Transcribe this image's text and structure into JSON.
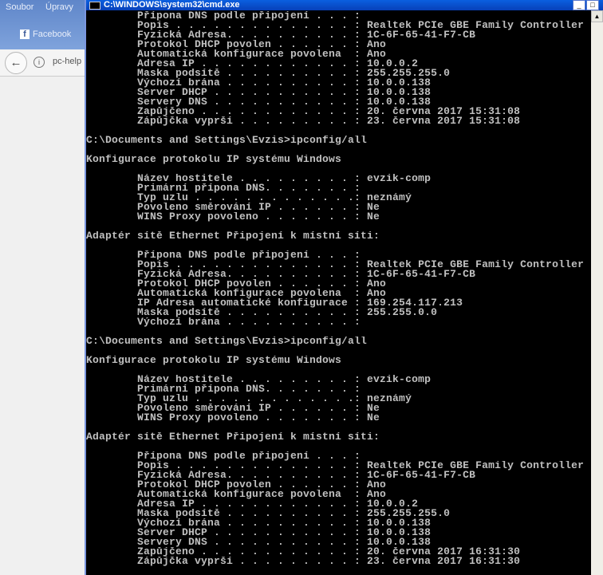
{
  "browser": {
    "menu": [
      "Soubor",
      "Úpravy"
    ],
    "facebook": "Facebook",
    "url": "pc-help",
    "back_icon": "←",
    "info_icon": "i"
  },
  "window": {
    "title": "C:\\WINDOWS\\system32\\cmd.exe",
    "min": "_",
    "max": "□"
  },
  "console": {
    "lines": [
      "        Přípona DNS podle připojení . . . : ",
      "        Popis . . . . . . . . . . . . . . : Realtek PCIe GBE Family Controller",
      "        Fyzická Adresa. . . . . . . . . . : 1C-6F-65-41-F7-CB",
      "        Protokol DHCP povolen . . . . . . : Ano",
      "        Automatická konfigurace povolena  : Ano",
      "        Adresa IP . . . . . . . . . . . . : 10.0.0.2",
      "        Maska podsítě . . . . . . . . . . : 255.255.255.0",
      "        Výchozí brána . . . . . . . . . . : 10.0.0.138",
      "        Server DHCP . . . . . . . . . . . : 10.0.0.138",
      "        Servery DNS . . . . . . . . . . . : 10.0.0.138",
      "        Zapůjčeno . . . . . . . . . . . . : 20. června 2017 15:31:08",
      "        Zápůjčka vyprší . . . . . . . . . : 23. června 2017 15:31:08",
      "",
      "C:\\Documents and Settings\\Evzis>ipconfig/all",
      "",
      "Konfigurace protokolu IP systému Windows",
      "",
      "        Název hostitele . . . . . . . . . : evzik-comp",
      "        Primární přípona DNS. . . . . . . : ",
      "        Typ uzlu . . . . . . . . . . . . .: neznámý",
      "        Povoleno směrování IP . . . . . . : Ne",
      "        WINS Proxy povoleno . . . . . . . : Ne",
      "",
      "Adaptér sítě Ethernet Připojení k místní síti:",
      "",
      "        Přípona DNS podle připojení . . . : ",
      "        Popis . . . . . . . . . . . . . . : Realtek PCIe GBE Family Controller",
      "        Fyzická Adresa. . . . . . . . . . : 1C-6F-65-41-F7-CB",
      "        Protokol DHCP povolen . . . . . . : Ano",
      "        Automatická konfigurace povolena  : Ano",
      "        IP Adresa automatické konfigurace : 169.254.117.213",
      "        Maska podsítě . . . . . . . . . . : 255.255.0.0",
      "        Výchozí brána . . . . . . . . . . : ",
      "",
      "C:\\Documents and Settings\\Evzis>ipconfig/all",
      "",
      "Konfigurace protokolu IP systému Windows",
      "",
      "        Název hostitele . . . . . . . . . : evzik-comp",
      "        Primární přípona DNS. . . . . . . : ",
      "        Typ uzlu . . . . . . . . . . . . .: neznámý",
      "        Povoleno směrování IP . . . . . . : Ne",
      "        WINS Proxy povoleno . . . . . . . : Ne",
      "",
      "Adaptér sítě Ethernet Připojení k místní síti:",
      "",
      "        Přípona DNS podle připojení . . . : ",
      "        Popis . . . . . . . . . . . . . . : Realtek PCIe GBE Family Controller",
      "        Fyzická Adresa. . . . . . . . . . : 1C-6F-65-41-F7-CB",
      "        Protokol DHCP povolen . . . . . . : Ano",
      "        Automatická konfigurace povolena  : Ano",
      "        Adresa IP . . . . . . . . . . . . : 10.0.0.2",
      "        Maska podsítě . . . . . . . . . . : 255.255.255.0",
      "        Výchozí brána . . . . . . . . . . : 10.0.0.138",
      "        Server DHCP . . . . . . . . . . . : 10.0.0.138",
      "        Servery DNS . . . . . . . . . . . : 10.0.0.138",
      "        Zapůjčeno . . . . . . . . . . . . : 20. června 2017 16:31:30",
      "        Zápůjčka vyprší . . . . . . . . . : 23. června 2017 16:31:30"
    ]
  }
}
